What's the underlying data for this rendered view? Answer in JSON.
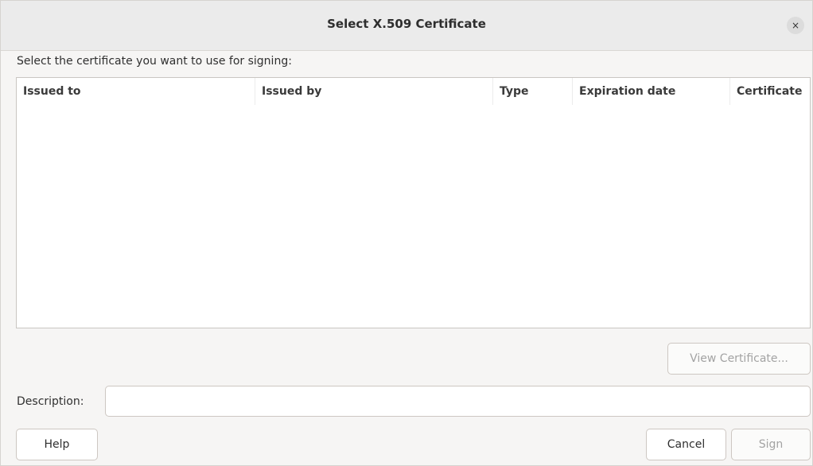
{
  "window": {
    "title": "Select X.509 Certificate",
    "close_glyph": "×",
    "close_icon": "close-icon"
  },
  "prompt": "Select the certificate you want to use for signing:",
  "table": {
    "columns": [
      "Issued to",
      "Issued by",
      "Type",
      "Expiration date",
      "Certificate"
    ],
    "rows": []
  },
  "buttons": {
    "view_certificate": "View Certificate...",
    "help": "Help",
    "cancel": "Cancel",
    "sign": "Sign"
  },
  "description": {
    "label": "Description:",
    "value": ""
  }
}
